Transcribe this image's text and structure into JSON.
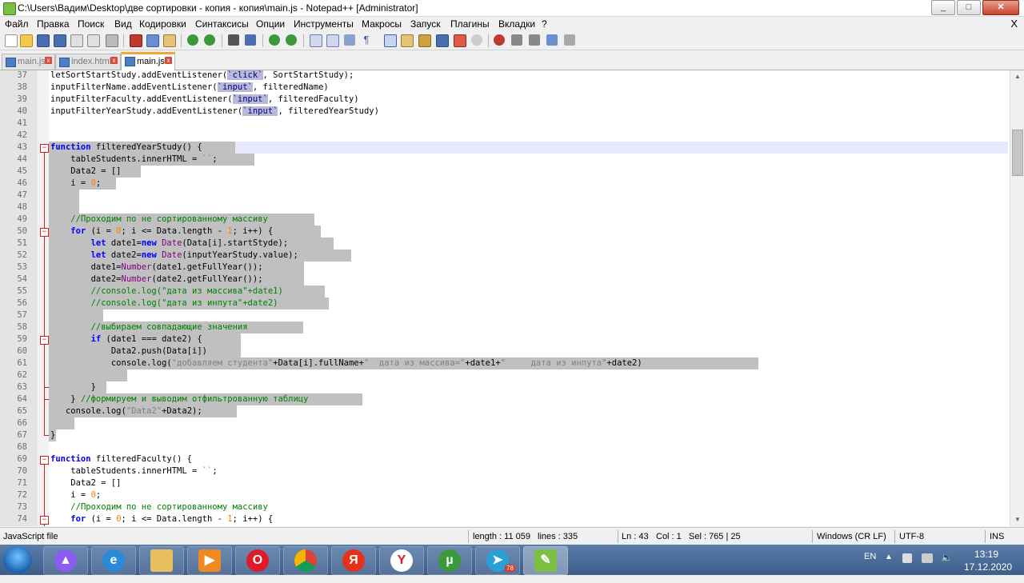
{
  "window": {
    "title": "C:\\Users\\Вадим\\Desktop\\две сортировки - копия - копия\\main.js - Notepad++ [Administrator]",
    "minimize": "_",
    "maximize": "□",
    "close": "✕"
  },
  "menu": {
    "items": [
      "Файл",
      "Правка",
      "Поиск",
      "Вид",
      "Кодировки",
      "Синтаксисы",
      "Опции",
      "Инструменты",
      "Макросы",
      "Запуск",
      "Плагины",
      "Вкладки",
      "?"
    ],
    "close": "X"
  },
  "tabs": [
    {
      "label": "main.js",
      "active": false
    },
    {
      "label": "index.html",
      "active": false
    },
    {
      "label": "main.js",
      "active": true
    }
  ],
  "tab_close": "x",
  "editor": {
    "lines": [
      {
        "n": "37",
        "html": "letSortStartStudy.addEventListener(<span class=\"strb\">`click`</span>, SortStartStudy);"
      },
      {
        "n": "38",
        "html": "inputFilterName.addEventListener(<span class=\"strb\">`input`</span>, filteredName)"
      },
      {
        "n": "39",
        "html": "inputFilterFaculty.addEventListener(<span class=\"strb\">`input`</span>, filteredFaculty)"
      },
      {
        "n": "40",
        "html": "inputFilterYearStudy.addEventListener(<span class=\"strb\">`input`</span>, filteredYearStudy)"
      },
      {
        "n": "41",
        "html": ""
      },
      {
        "n": "42",
        "html": ""
      },
      {
        "n": "43",
        "html": "<span class=\"kw\">function</span> filteredYearStudy() {"
      },
      {
        "n": "44",
        "html": "    tableStudents.innerHTML = <span class=\"str\">``</span>;"
      },
      {
        "n": "45",
        "html": "    Data2 = []"
      },
      {
        "n": "46",
        "html": "    i = <span class=\"num\">0</span>;"
      },
      {
        "n": "47",
        "html": ""
      },
      {
        "n": "48",
        "html": ""
      },
      {
        "n": "49",
        "html": "    <span class=\"cm\">//Проходим по не сортированному массиву</span>"
      },
      {
        "n": "50",
        "html": "    <span class=\"kw\">for</span> (i = <span class=\"num\">0</span>; i &lt;= Data.length - <span class=\"num\">1</span>; i++) {"
      },
      {
        "n": "51",
        "html": "        <span class=\"kw\">let</span> date1=<span class=\"kw\">new</span> <span class=\"fn\">Date</span>(Data[i].startStyde);"
      },
      {
        "n": "52",
        "html": "        <span class=\"kw\">let</span> date2=<span class=\"kw\">new</span> <span class=\"fn\">Date</span>(inputYearStudy.value);"
      },
      {
        "n": "53",
        "html": "        date1=<span class=\"fn\">Number</span>(date1.getFullYear());"
      },
      {
        "n": "54",
        "html": "        date2=<span class=\"fn\">Number</span>(date2.getFullYear());"
      },
      {
        "n": "55",
        "html": "        <span class=\"cm\">//console.log(\"дата из массива\"+date1)</span>"
      },
      {
        "n": "56",
        "html": "        <span class=\"cm\">//console.log(\"дата из инпута\"+date2)</span>"
      },
      {
        "n": "57",
        "html": ""
      },
      {
        "n": "58",
        "html": "        <span class=\"cm\">//выбираем совпадающие значения</span>"
      },
      {
        "n": "59",
        "html": "        <span class=\"kw\">if</span> (date1 === date2) {"
      },
      {
        "n": "60",
        "html": "            Data2.push(Data[i])"
      },
      {
        "n": "61",
        "html": "            console.log(<span class=\"str\">\"добавляем студента\"</span>+Data[i].fullName+<span class=\"str\">\"  дата из массива=\"</span>+date1+<span class=\"str\">\"     дата из инпута\"</span>+date2)"
      },
      {
        "n": "62",
        "html": ""
      },
      {
        "n": "63",
        "html": "        }"
      },
      {
        "n": "64",
        "html": "    } <span class=\"cm\">//формируем и выводим отфильтрованную таблицу</span>"
      },
      {
        "n": "65",
        "html": "   console.log(<span class=\"str\">\"Data2\"</span>+Data2);"
      },
      {
        "n": "66",
        "html": ""
      },
      {
        "n": "67",
        "html": "}"
      },
      {
        "n": "68",
        "html": ""
      },
      {
        "n": "69",
        "html": "<span class=\"kw\">function</span> filteredFaculty() {"
      },
      {
        "n": "70",
        "html": "    tableStudents.innerHTML = <span class=\"str\">``</span>;"
      },
      {
        "n": "71",
        "html": "    Data2 = []"
      },
      {
        "n": "72",
        "html": "    i = <span class=\"num\">0</span>;"
      },
      {
        "n": "73",
        "html": "    <span class=\"cm\">//Проходим по не сортированному массиву</span>"
      },
      {
        "n": "74",
        "html": "    <span class=\"kw\">for</span> (i = <span class=\"num\">0</span>; i &lt;= Data.length - <span class=\"num\">1</span>; i++) {"
      }
    ]
  },
  "status": {
    "language": "JavaScript file",
    "length": "length : 11 059",
    "lines": "lines : 335",
    "ln": "Ln : 43",
    "col": "Col : 1",
    "sel": "Sel : 765 | 25",
    "eol": "Windows (CR LF)",
    "encoding": "UTF-8",
    "mode": "INS"
  },
  "taskbar": {
    "lang": "EN",
    "time": "13:19",
    "date": "17.12.2020",
    "telegram_badge": "78"
  },
  "colors": {
    "selection": "#c0c0c0",
    "current_line": "#e8e8ff",
    "keyword": "#0000ff",
    "comment": "#008000",
    "number": "#ff8000",
    "string": "#808080",
    "tab_accent": "#f4a23a"
  }
}
